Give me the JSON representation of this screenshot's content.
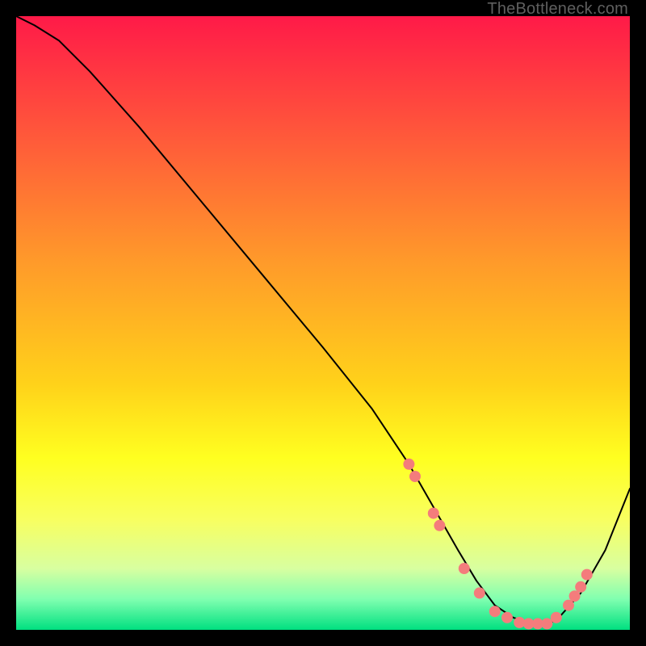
{
  "watermark": "TheBottleneck.com",
  "chart_data": {
    "type": "line",
    "title": "",
    "xlabel": "",
    "ylabel": "",
    "xlim": [
      0,
      100
    ],
    "ylim": [
      0,
      100
    ],
    "gradient_stops": [
      {
        "offset": 0.0,
        "color": "#ff1a48"
      },
      {
        "offset": 0.2,
        "color": "#ff5a3a"
      },
      {
        "offset": 0.4,
        "color": "#ff9a2a"
      },
      {
        "offset": 0.6,
        "color": "#ffd21a"
      },
      {
        "offset": 0.72,
        "color": "#ffff20"
      },
      {
        "offset": 0.82,
        "color": "#f8ff60"
      },
      {
        "offset": 0.9,
        "color": "#d8ffa0"
      },
      {
        "offset": 0.95,
        "color": "#80ffb0"
      },
      {
        "offset": 1.0,
        "color": "#00e080"
      }
    ],
    "series": [
      {
        "name": "curve",
        "stroke": "#000000",
        "stroke_width": 2,
        "x": [
          0,
          3,
          7,
          12,
          20,
          30,
          40,
          50,
          58,
          64,
          68,
          72,
          75,
          78,
          81,
          84,
          86,
          88,
          92,
          96,
          100
        ],
        "y": [
          100,
          98.5,
          96,
          91,
          82,
          70,
          58,
          46,
          36,
          27,
          20,
          13,
          8,
          4,
          2,
          1,
          1,
          1.5,
          6,
          13,
          23
        ]
      }
    ],
    "markers": {
      "color": "#f47c7c",
      "radius": 7,
      "points": [
        {
          "x": 64,
          "y": 27
        },
        {
          "x": 65,
          "y": 25
        },
        {
          "x": 68,
          "y": 19
        },
        {
          "x": 69,
          "y": 17
        },
        {
          "x": 73,
          "y": 10
        },
        {
          "x": 75.5,
          "y": 6
        },
        {
          "x": 78,
          "y": 3
        },
        {
          "x": 80,
          "y": 2
        },
        {
          "x": 82,
          "y": 1.2
        },
        {
          "x": 83.5,
          "y": 1
        },
        {
          "x": 85,
          "y": 1
        },
        {
          "x": 86.5,
          "y": 1
        },
        {
          "x": 88,
          "y": 2
        },
        {
          "x": 90,
          "y": 4
        },
        {
          "x": 91,
          "y": 5.5
        },
        {
          "x": 92,
          "y": 7
        },
        {
          "x": 93,
          "y": 9
        }
      ]
    }
  }
}
